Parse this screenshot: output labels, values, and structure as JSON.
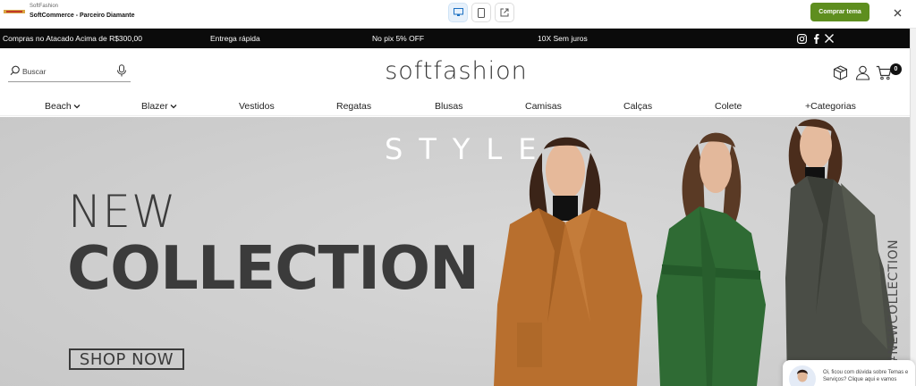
{
  "preview_bar": {
    "store_name": "SoftFashion",
    "partner_label": "SoftCommerce - Parceiro Diamante",
    "buy_button": "Comprar tema",
    "devices": [
      "desktop-icon",
      "mobile-icon",
      "external-link-icon"
    ],
    "close_icon": "close-icon",
    "buy_color": "#5e8e1f"
  },
  "announcement": {
    "messages": [
      "Compras no Atacado Acima de R$300,00",
      "Entrega rápida",
      "No pix 5% OFF",
      "10X Sem juros"
    ],
    "social": [
      "instagram-icon",
      "facebook-icon",
      "x-icon"
    ]
  },
  "header": {
    "search_placeholder": "Buscar",
    "brand": "softfashion",
    "icons": [
      "box-icon",
      "user-icon",
      "cart-icon"
    ],
    "cart_count": "0"
  },
  "nav": {
    "items": [
      {
        "label": "Beach",
        "dropdown": true
      },
      {
        "label": "Blazer",
        "dropdown": true
      },
      {
        "label": "Vestidos",
        "dropdown": false
      },
      {
        "label": "Regatas",
        "dropdown": false
      },
      {
        "label": "Blusas",
        "dropdown": false
      },
      {
        "label": "Camisas",
        "dropdown": false
      },
      {
        "label": "Calças",
        "dropdown": false
      },
      {
        "label": "Colete",
        "dropdown": false
      },
      {
        "label": "+Categorias",
        "dropdown": false
      }
    ]
  },
  "hero": {
    "style_word": "STYLE",
    "line1": "NEW",
    "line2": "COLLECTION",
    "cta": "SHOP NOW",
    "hashtag": "#NEWCOLLECTION",
    "colors": {
      "background": "#cfcfcf",
      "coat_camel": "#b86f2e",
      "coat_green": "#2f6b34",
      "coat_gray": "#4a4d46"
    }
  },
  "chat": {
    "message": "Oi, ficou com dúvida sobre Temas e Serviços? Clique aqui e vamos"
  }
}
